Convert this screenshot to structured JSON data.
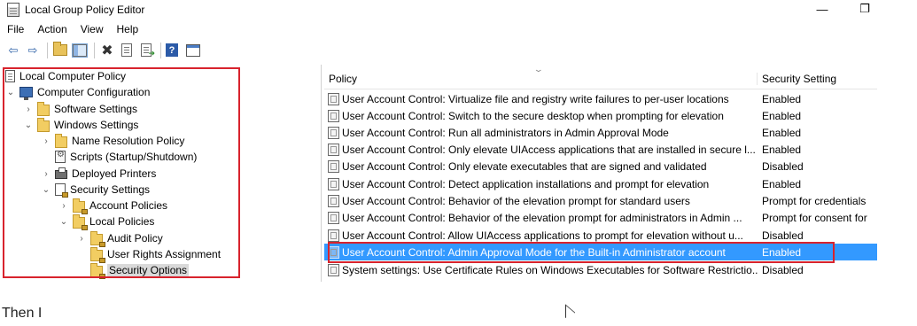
{
  "window": {
    "title": "Local Group Policy Editor",
    "minimize_glyph": "—",
    "restore_glyph": "❐"
  },
  "menu": {
    "items": [
      "File",
      "Action",
      "View",
      "Help"
    ]
  },
  "toolbar": {
    "back_glyph": "⇦",
    "forward_glyph": "⇨",
    "delete_glyph": "✖",
    "help_glyph": "?"
  },
  "tree": {
    "root": "Local Computer Policy",
    "computer_configuration": "Computer Configuration",
    "software_settings": "Software Settings",
    "windows_settings": "Windows Settings",
    "name_resolution_policy": "Name Resolution Policy",
    "scripts": "Scripts (Startup/Shutdown)",
    "deployed_printers": "Deployed Printers",
    "security_settings": "Security Settings",
    "account_policies": "Account Policies",
    "local_policies": "Local Policies",
    "audit_policy": "Audit Policy",
    "user_rights_assignment": "User Rights Assignment",
    "security_options": "Security Options"
  },
  "list": {
    "columns": {
      "policy": "Policy",
      "setting": "Security Setting"
    },
    "rows": [
      {
        "policy": "User Account Control: Virtualize file and registry write failures to per-user locations",
        "setting": "Enabled"
      },
      {
        "policy": "User Account Control: Switch to the secure desktop when prompting for elevation",
        "setting": "Enabled"
      },
      {
        "policy": "User Account Control: Run all administrators in Admin Approval Mode",
        "setting": "Enabled"
      },
      {
        "policy": "User Account Control: Only elevate UIAccess applications that are installed in secure l...",
        "setting": "Enabled"
      },
      {
        "policy": "User Account Control: Only elevate executables that are signed and validated",
        "setting": "Disabled"
      },
      {
        "policy": "User Account Control: Detect application installations and prompt for elevation",
        "setting": "Enabled"
      },
      {
        "policy": "User Account Control: Behavior of the elevation prompt for standard users",
        "setting": "Prompt for credentials"
      },
      {
        "policy": "User Account Control: Behavior of the elevation prompt for administrators in Admin ...",
        "setting": "Prompt for consent for"
      },
      {
        "policy": "User Account Control: Allow UIAccess applications to prompt for elevation without u...",
        "setting": "Disabled"
      },
      {
        "policy": "User Account Control: Admin Approval Mode for the Built-in Administrator account",
        "setting": "Enabled"
      },
      {
        "policy": "System settings: Use Certificate Rules on Windows Executables for Software Restrictio...",
        "setting": "Disabled"
      }
    ]
  },
  "colors": {
    "selection": "#3399ff",
    "highlight_box": "#d8232d"
  },
  "footer_text": "Then I"
}
